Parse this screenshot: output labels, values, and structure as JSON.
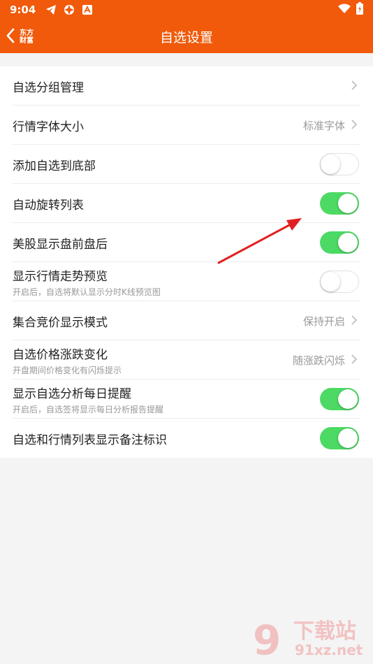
{
  "status_bar": {
    "time": "9:04"
  },
  "header": {
    "title": "自选设置",
    "logo_line1": "东方",
    "logo_line2": "财富"
  },
  "rows": [
    {
      "label": "自选分组管理",
      "type": "nav",
      "value": ""
    },
    {
      "label": "行情字体大小",
      "type": "nav",
      "value": "标准字体"
    },
    {
      "label": "添加自选到底部",
      "type": "toggle",
      "on": false
    },
    {
      "label": "自动旋转列表",
      "type": "toggle",
      "on": true
    },
    {
      "label": "美股显示盘前盘后",
      "type": "toggle",
      "on": true
    },
    {
      "label": "显示行情走势预览",
      "sub": "开启后，自选将默认显示分时K线预览图",
      "type": "toggle",
      "on": false
    },
    {
      "label": "集合竞价显示模式",
      "type": "nav",
      "value": "保持开启"
    },
    {
      "label": "自选价格涨跌变化",
      "sub": "开盘期间价格变化有闪烁提示",
      "type": "nav",
      "value": "随涨跌闪烁"
    },
    {
      "label": "显示自选分析每日提醒",
      "sub": "开启后，自选签将显示每日分析报告提醒",
      "type": "toggle",
      "on": true
    },
    {
      "label": "自选和行情列表显示备注标识",
      "type": "toggle",
      "on": true
    }
  ],
  "watermark": {
    "text": "下载站",
    "url_text": "91xz.net"
  },
  "colors": {
    "brand": "#f05a0a",
    "toggle_on": "#4cd964",
    "annotation_arrow": "#e02020"
  }
}
